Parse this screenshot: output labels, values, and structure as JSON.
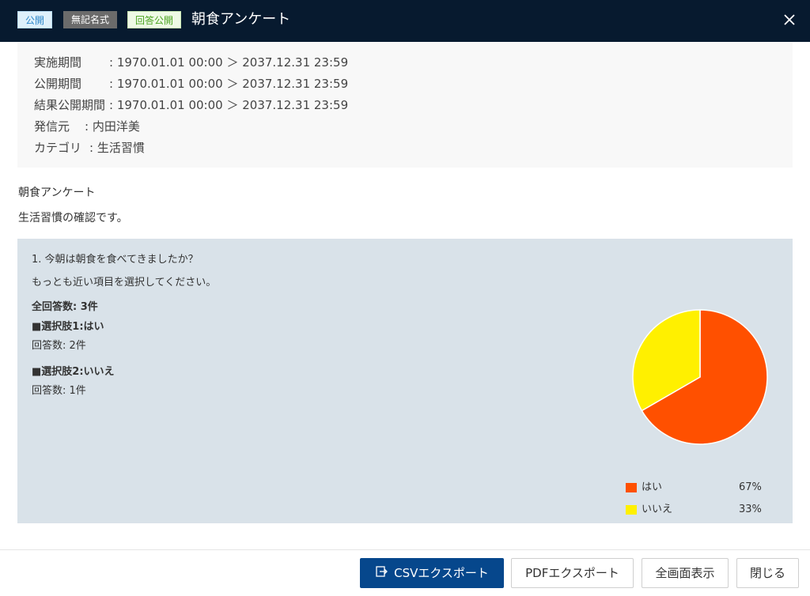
{
  "header": {
    "badges": {
      "public": "公開",
      "anonymous": "無記名式",
      "result_public": "回答公開"
    },
    "title": "朝食アンケート",
    "close_icon": "close-icon"
  },
  "info": {
    "rows": [
      {
        "label": "実施期間",
        "value": ": 1970.01.01 00:00 ＞ 2037.12.31 23:59"
      },
      {
        "label": "公開期間",
        "value": ": 1970.01.01 00:00 ＞ 2037.12.31 23:59"
      },
      {
        "label": "結果公開期間",
        "value": ": 1970.01.01 00:00 ＞ 2037.12.31 23:59"
      },
      {
        "label": "発信元",
        "value": ": 内田洋美"
      },
      {
        "label": "カテゴリ",
        "value": ": 生活習慣"
      }
    ]
  },
  "survey": {
    "name": "朝食アンケート",
    "description": "生活習慣の確認です。"
  },
  "question": {
    "title": "1. 今朝は朝食を食べてきましたか？",
    "instruction": "もっとも近い項目を選択してください。",
    "total": "全回答数: 3件",
    "options": [
      {
        "heading": "■選択肢1:はい",
        "count": "回答数: 2件"
      },
      {
        "heading": "■選択肢2:いいえ",
        "count": "回答数: 1件"
      }
    ]
  },
  "chart_data": {
    "type": "pie",
    "labels": [
      "はい",
      "いいえ"
    ],
    "values": [
      2,
      1
    ],
    "percent_labels": [
      "67%",
      "33%"
    ],
    "colors": [
      "#ff5000",
      "#fff000"
    ],
    "legend_position": "bottom-right"
  },
  "footer": {
    "csv_label": "CSVエクスポート",
    "pdf_label": "PDFエクスポート",
    "fullscreen_label": "全画面表示",
    "close_label": "閉じる"
  }
}
